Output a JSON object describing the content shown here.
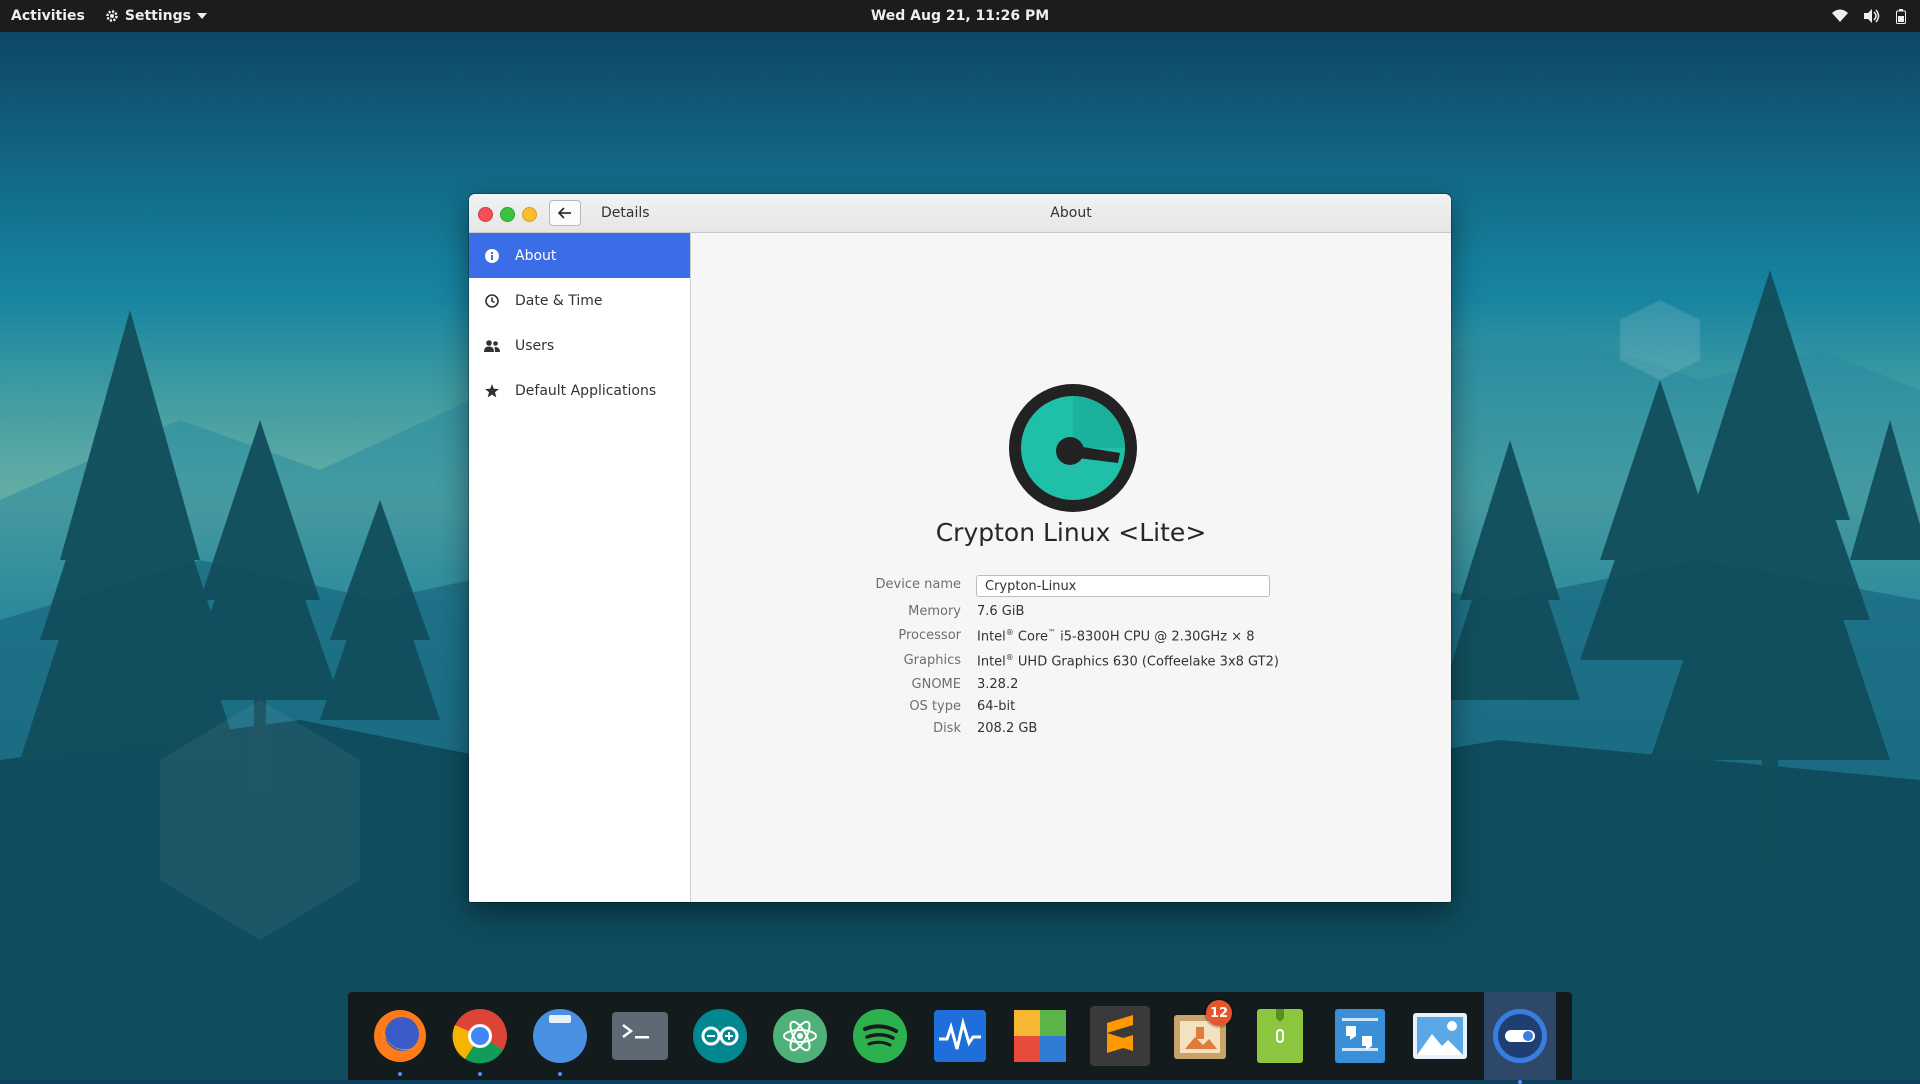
{
  "topbar": {
    "activities": "Activities",
    "app_menu": "Settings",
    "clock": "Wed Aug 21, 11:26 PM",
    "tray_icons": [
      "wifi-icon",
      "volume-icon",
      "battery-icon"
    ]
  },
  "window": {
    "sidebar_title": "Details",
    "main_title": "About",
    "controls": [
      "close",
      "maximize",
      "minimize"
    ]
  },
  "sidebar": {
    "items": [
      {
        "label": "About",
        "icon": "info-icon",
        "active": true
      },
      {
        "label": "Date & Time",
        "icon": "clock-icon",
        "active": false
      },
      {
        "label": "Users",
        "icon": "users-icon",
        "active": false
      },
      {
        "label": "Default Applications",
        "icon": "star-icon",
        "active": false
      }
    ]
  },
  "about": {
    "distro_name": "Crypton Linux <Lite>",
    "device_name_label": "Device name",
    "device_name_value": "Crypton-Linux",
    "memory_label": "Memory",
    "memory_value": "7.6 GiB",
    "processor_label": "Processor",
    "processor_value": {
      "a": "Intel",
      "b": "Core",
      "c": "i5-8300H CPU @ 2.30GHz × 8"
    },
    "graphics_label": "Graphics",
    "graphics_value": {
      "a": "Intel",
      "b": "UHD Graphics 630 (Coffeelake 3x8 GT2)"
    },
    "gnome_label": "GNOME",
    "gnome_value": "3.28.2",
    "os_type_label": "OS type",
    "os_type_value": "64-bit",
    "disk_label": "Disk",
    "disk_value": "208.2 GB"
  },
  "dock": {
    "apps": [
      {
        "name": "firefox-icon"
      },
      {
        "name": "chrome-icon"
      },
      {
        "name": "files-icon"
      },
      {
        "name": "terminal-icon"
      },
      {
        "name": "arduino-icon"
      },
      {
        "name": "atom-icon"
      },
      {
        "name": "spotify-icon"
      },
      {
        "name": "system-monitor-icon"
      },
      {
        "name": "palette-icon"
      },
      {
        "name": "sublime-text-icon"
      },
      {
        "name": "updates-icon",
        "badge": "12"
      },
      {
        "name": "archive-icon"
      },
      {
        "name": "quote-icon"
      },
      {
        "name": "image-viewer-icon"
      },
      {
        "name": "settings-toggle-icon",
        "active": true
      }
    ]
  },
  "colors": {
    "accent": "#3b6de8",
    "logo_teal": "#1fbfa8",
    "logo_dark": "#222222"
  }
}
